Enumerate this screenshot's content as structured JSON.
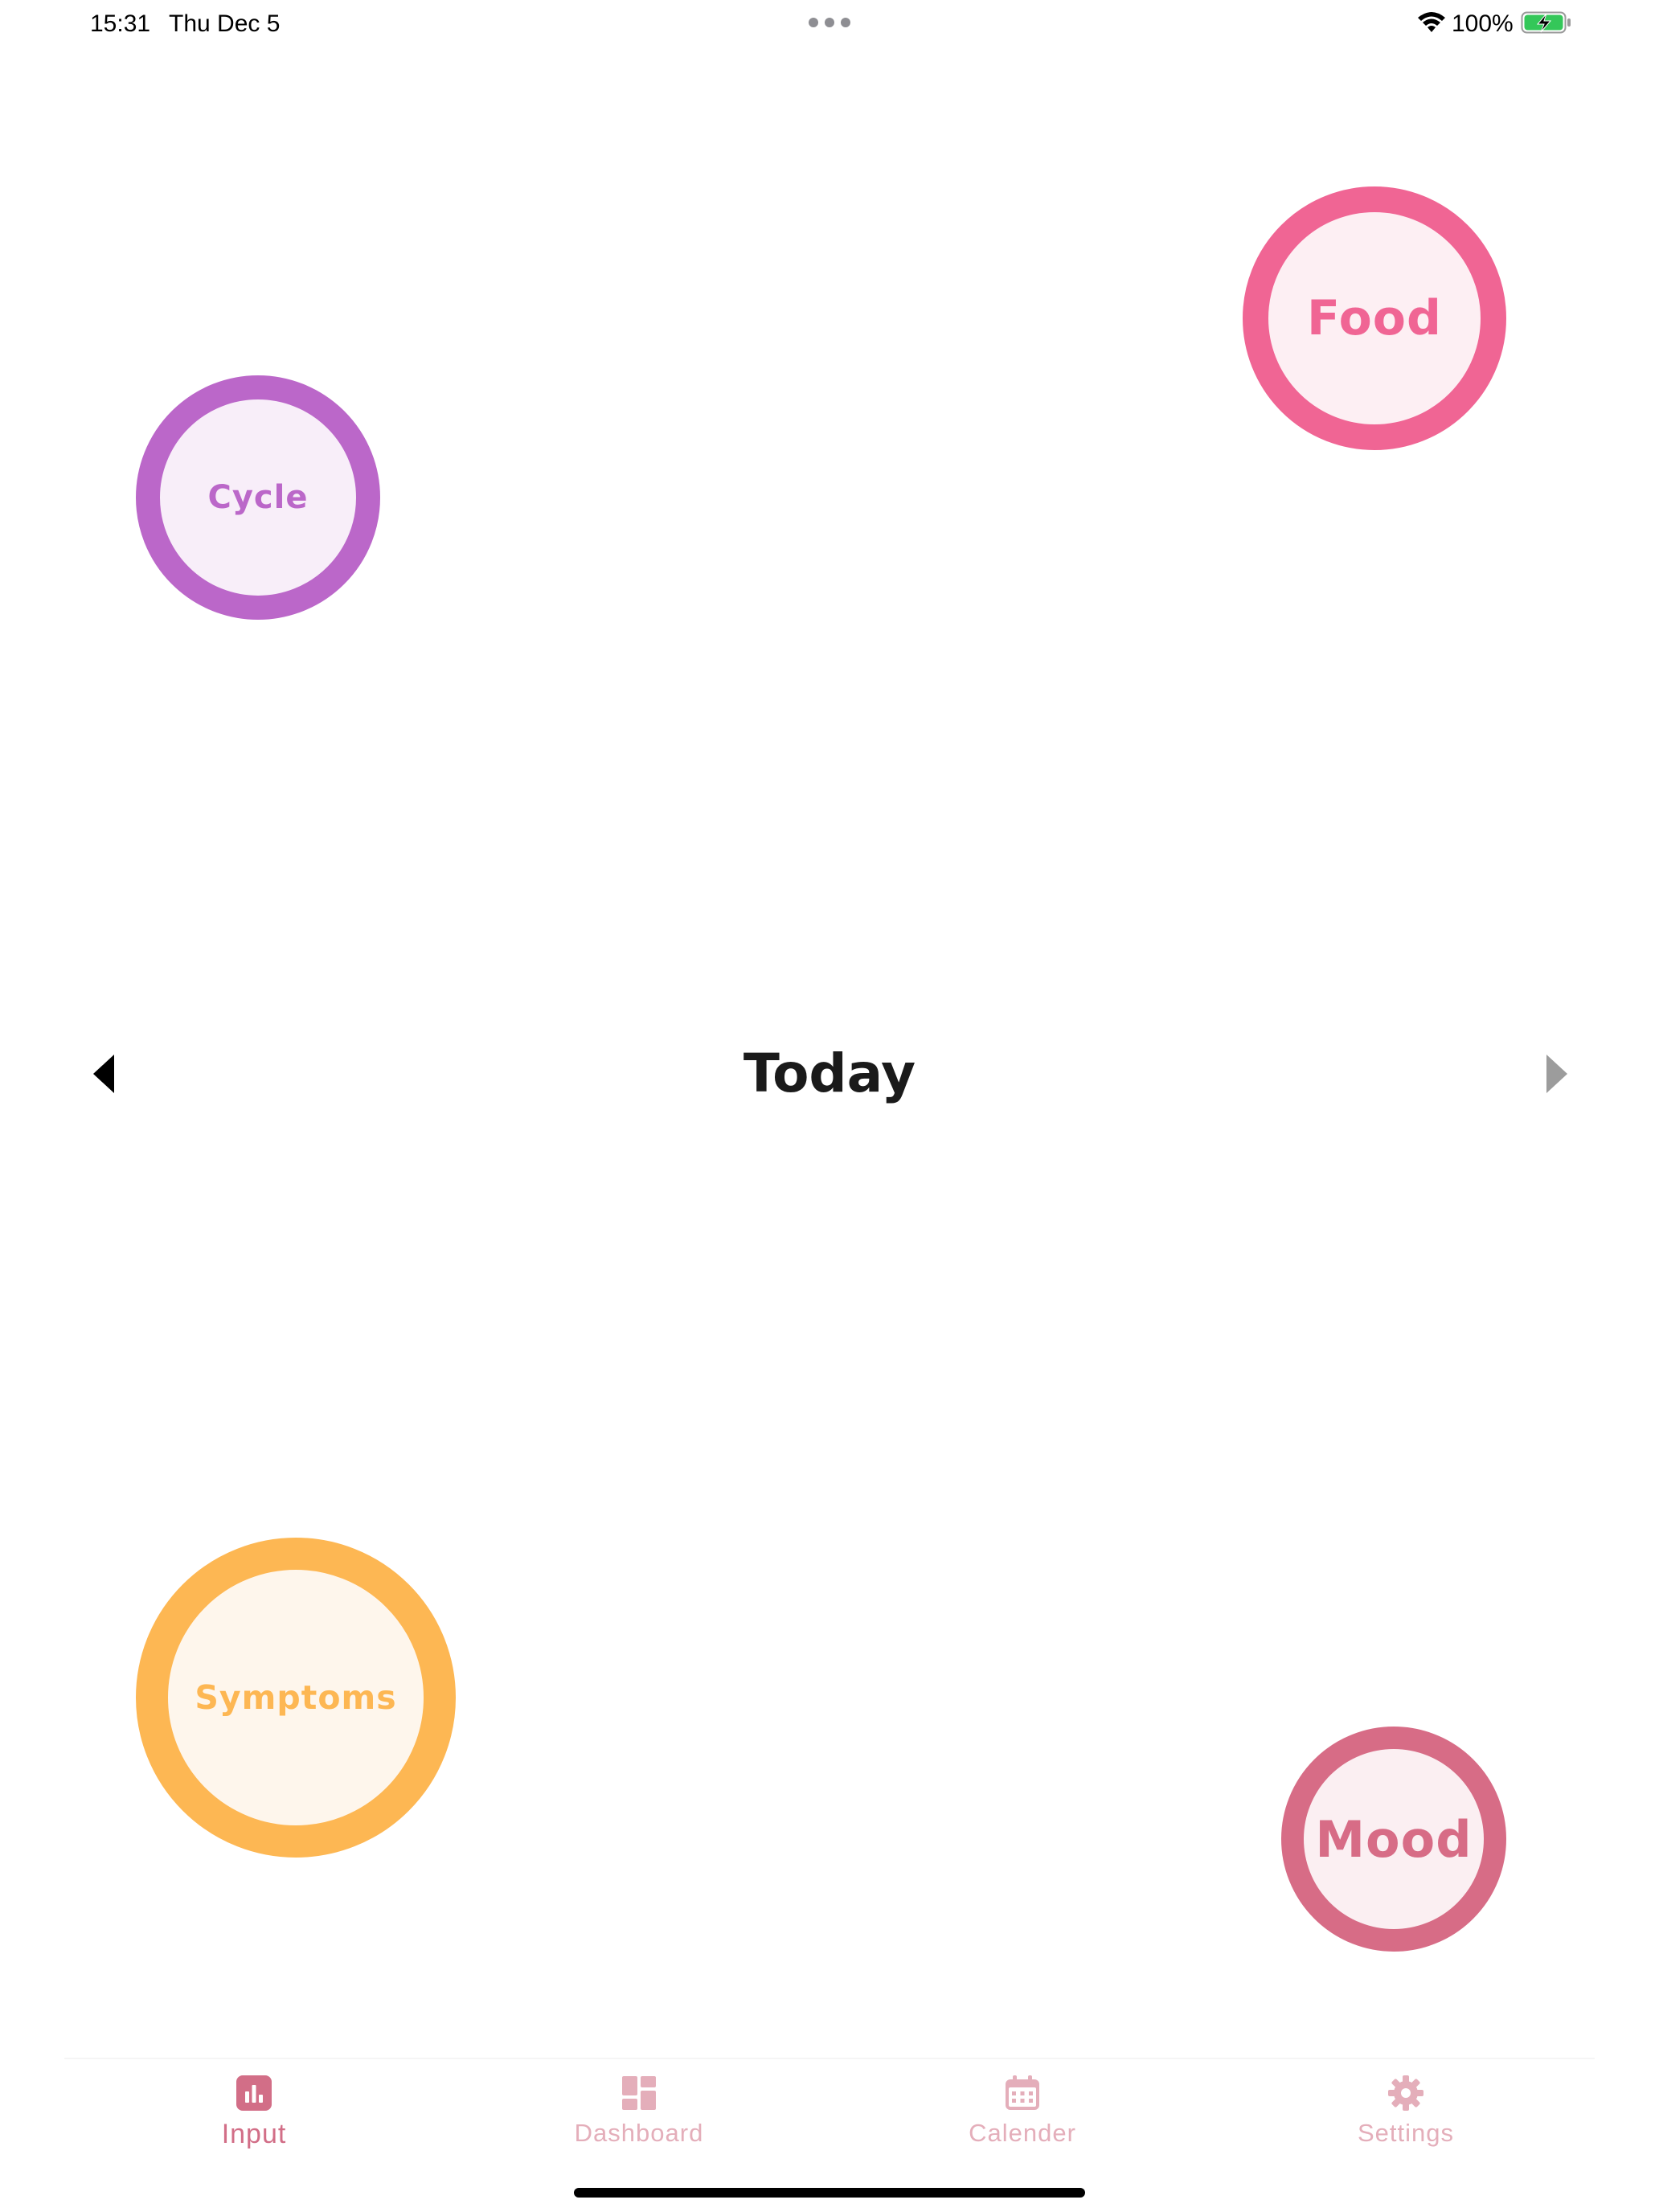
{
  "status_bar": {
    "time": "15:31",
    "date": "Thu Dec 5",
    "battery_percent": "100%",
    "battery_level": 1.0,
    "battery_charging": true,
    "icons": [
      "more-dots-icon",
      "wifi-icon",
      "battery-charging-icon"
    ]
  },
  "categories": {
    "cycle": {
      "label": "Cycle",
      "color": "#bb67c9",
      "fill": "#f8eef9"
    },
    "food": {
      "label": "Food",
      "color": "#f06594",
      "fill": "#fdeff3"
    },
    "symptoms": {
      "label": "Symptoms",
      "color": "#fdb753",
      "fill": "#fef6ec"
    },
    "mood": {
      "label": "Mood",
      "color": "#d76c86",
      "fill": "#fbeff2"
    }
  },
  "date_nav": {
    "title": "Today",
    "prev_icon": "triangle-left-icon",
    "next_icon": "triangle-right-icon",
    "next_enabled": false
  },
  "tabbar": {
    "active_color": "#d26e87",
    "inactive_color": "#e4aeba",
    "tabs": [
      {
        "label": "Input",
        "icon": "chart-bar-icon",
        "active": true
      },
      {
        "label": "Dashboard",
        "icon": "dashboard-grid-icon",
        "active": false
      },
      {
        "label": "Calender",
        "icon": "calendar-icon",
        "active": false
      },
      {
        "label": "Settings",
        "icon": "gear-icon",
        "active": false
      }
    ]
  }
}
